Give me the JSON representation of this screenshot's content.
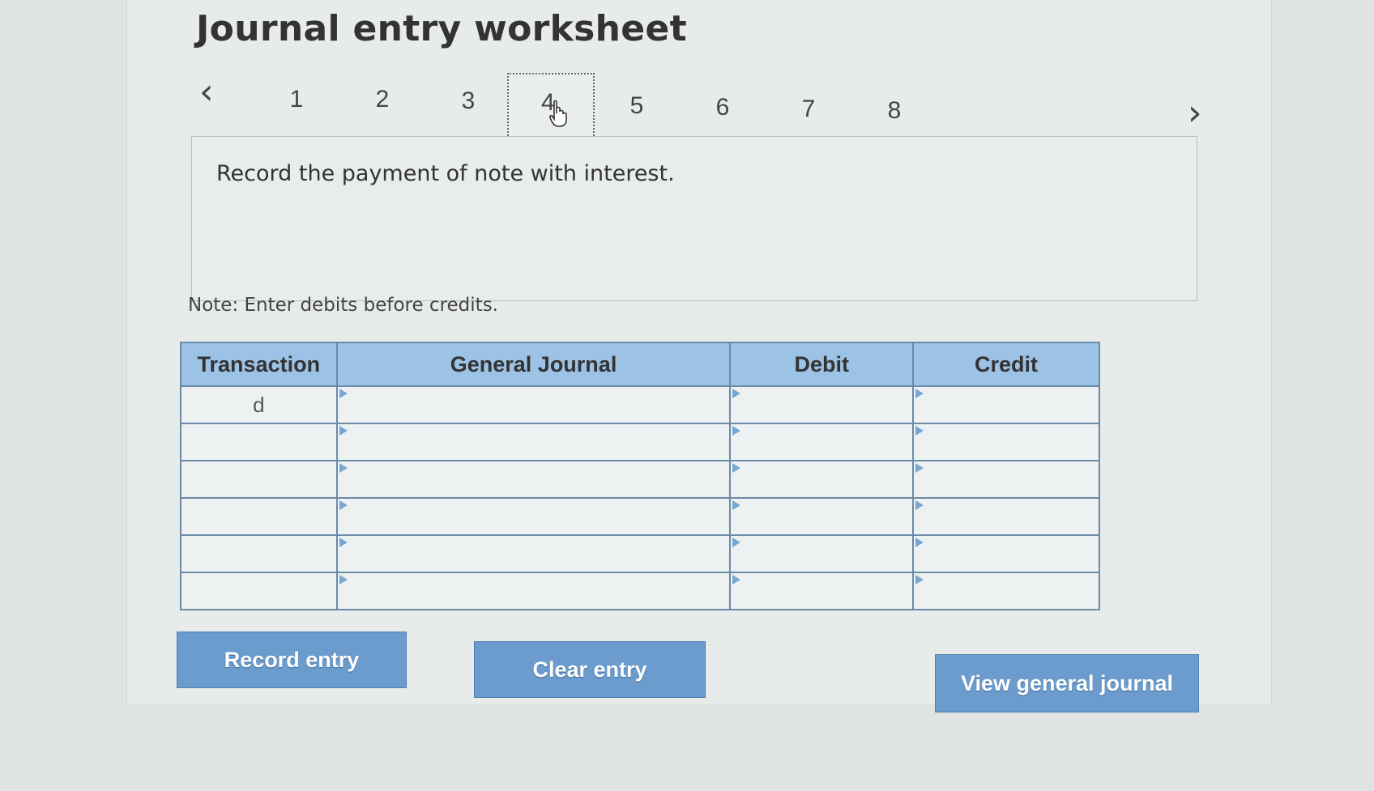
{
  "title": "Journal entry worksheet",
  "pager": {
    "prev_icon": "chevron-left-icon",
    "next_icon": "chevron-right-icon",
    "pages": [
      "1",
      "2",
      "3",
      "4",
      "5",
      "6",
      "7",
      "8"
    ],
    "active_page": "4"
  },
  "instruction": "Record the payment of note with interest.",
  "note": "Note: Enter debits before credits.",
  "table": {
    "headers": [
      "Transaction",
      "General Journal",
      "Debit",
      "Credit"
    ],
    "rows": [
      {
        "transaction": "d",
        "account": "",
        "debit": "",
        "credit": ""
      },
      {
        "transaction": "",
        "account": "",
        "debit": "",
        "credit": ""
      },
      {
        "transaction": "",
        "account": "",
        "debit": "",
        "credit": ""
      },
      {
        "transaction": "",
        "account": "",
        "debit": "",
        "credit": ""
      },
      {
        "transaction": "",
        "account": "",
        "debit": "",
        "credit": ""
      },
      {
        "transaction": "",
        "account": "",
        "debit": "",
        "credit": ""
      }
    ]
  },
  "buttons": {
    "record": "Record entry",
    "clear": "Clear entry",
    "view": "View general journal"
  },
  "colors": {
    "header_bg": "#9cc3e5",
    "button_bg": "#6b9ccd",
    "grid": "#6a8aa8"
  }
}
